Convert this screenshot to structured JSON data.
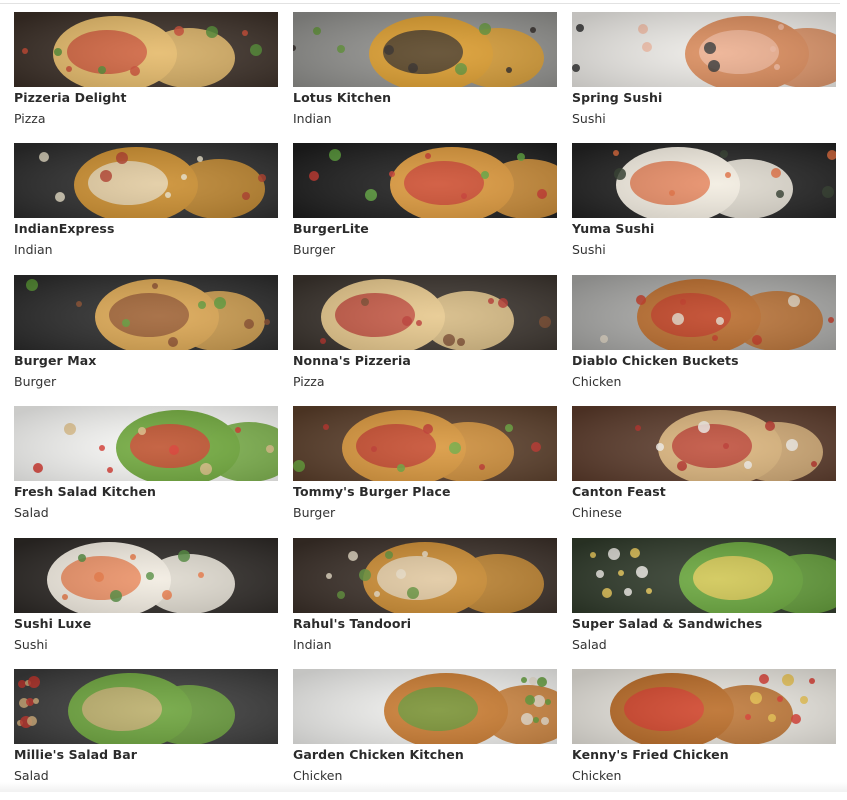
{
  "restaurants": [
    {
      "name": "Pizzeria Delight",
      "cuisine": "Pizza",
      "image": "pizza-photo",
      "colors": {
        "bg": "#3a2e26",
        "main": "#e3b867",
        "accent": "#c8452f",
        "detail": "#4f8a2f"
      }
    },
    {
      "name": "Lotus Kitchen",
      "cuisine": "Indian",
      "image": "curry-bowl-photo",
      "colors": {
        "bg": "#8f8f8c",
        "main": "#d99a2b",
        "accent": "#2b2421",
        "detail": "#5e9234"
      }
    },
    {
      "name": "Spring Sushi",
      "cuisine": "Sushi",
      "image": "sushi-board-photo",
      "colors": {
        "bg": "#eceae6",
        "main": "#d98a5a",
        "accent": "#f1b9a0",
        "detail": "#2f2f2f"
      }
    },
    {
      "name": "IndianExpress",
      "cuisine": "Indian",
      "image": "indian-dishes-photo",
      "colors": {
        "bg": "#2c2c2c",
        "main": "#c98b2b",
        "accent": "#e8dfc7",
        "detail": "#b03a26"
      }
    },
    {
      "name": "BurgerLite",
      "cuisine": "Burger",
      "image": "two-burgers-photo",
      "colors": {
        "bg": "#1d1d1d",
        "main": "#d99538",
        "accent": "#c8352c",
        "detail": "#5da43b"
      }
    },
    {
      "name": "Yuma Sushi",
      "cuisine": "Sushi",
      "image": "sushi-rolls-photo",
      "colors": {
        "bg": "#222222",
        "main": "#f2ece0",
        "accent": "#e26a3a",
        "detail": "#2f3b2a"
      }
    },
    {
      "name": "Burger Max",
      "cuisine": "Burger",
      "image": "burgers-photo",
      "colors": {
        "bg": "#2b2b2b",
        "main": "#d9a44f",
        "accent": "#8a4b2a",
        "detail": "#5a9a35"
      }
    },
    {
      "name": "Nonna's Pizzeria",
      "cuisine": "Pizza",
      "image": "pizza-slices-photo",
      "colors": {
        "bg": "#3a332d",
        "main": "#e6c78b",
        "accent": "#b9342d",
        "detail": "#7b4a2e"
      }
    },
    {
      "name": "Diablo Chicken Buckets",
      "cuisine": "Chicken",
      "image": "fried-chicken-sauce-photo",
      "colors": {
        "bg": "#a8a8a6",
        "main": "#b86a2a",
        "accent": "#c0331f",
        "detail": "#e0d6c4"
      }
    },
    {
      "name": "Fresh Salad Kitchen",
      "cuisine": "Salad",
      "image": "salad-bowl-photo",
      "colors": {
        "bg": "#f7f7f5",
        "main": "#6fa83b",
        "accent": "#d8342a",
        "detail": "#e2c28a"
      }
    },
    {
      "name": "Tommy's Burger Place",
      "cuisine": "Burger",
      "image": "burger-fries-photo",
      "colors": {
        "bg": "#5a3e2a",
        "main": "#d8953a",
        "accent": "#c0332a",
        "detail": "#6aa83c"
      }
    },
    {
      "name": "Canton Feast",
      "cuisine": "Chinese",
      "image": "noodle-bowl-photo",
      "colors": {
        "bg": "#5b3b2b",
        "main": "#d9b27a",
        "accent": "#b52c25",
        "detail": "#f3f0ea"
      }
    },
    {
      "name": "Sushi Luxe",
      "cuisine": "Sushi",
      "image": "sushi-platter-photo",
      "colors": {
        "bg": "#2d2926",
        "main": "#f1ebe0",
        "accent": "#e9733e",
        "detail": "#4f8a3a"
      }
    },
    {
      "name": "Rahul's Tandoori",
      "cuisine": "Indian",
      "image": "indian-spread-photo",
      "colors": {
        "bg": "#3a2f28",
        "main": "#c9892f",
        "accent": "#e7dcc5",
        "detail": "#5e8f36"
      }
    },
    {
      "name": "Super Salad & Sandwiches",
      "cuisine": "Salad",
      "image": "egg-salad-photo",
      "colors": {
        "bg": "#2f3a2a",
        "main": "#67a53a",
        "accent": "#f2d05a",
        "detail": "#f7f4ee"
      }
    },
    {
      "name": "Millie's Salad Bar",
      "cuisine": "Salad",
      "image": "chicken-salad-photo",
      "colors": {
        "bg": "#3a3a3a",
        "main": "#6aa23a",
        "accent": "#d6b07a",
        "detail": "#c7352c"
      }
    },
    {
      "name": "Garden Chicken Kitchen",
      "cuisine": "Chicken",
      "image": "fried-chicken-photo",
      "colors": {
        "bg": "#efefed",
        "main": "#c97a2f",
        "accent": "#5c9a34",
        "detail": "#e9dfcf"
      }
    },
    {
      "name": "Kenny's Fried Chicken",
      "cuisine": "Chicken",
      "image": "fried-chicken-fries-photo",
      "colors": {
        "bg": "#e7e4dd",
        "main": "#b96a25",
        "accent": "#d8352a",
        "detail": "#e9c14a"
      }
    }
  ]
}
